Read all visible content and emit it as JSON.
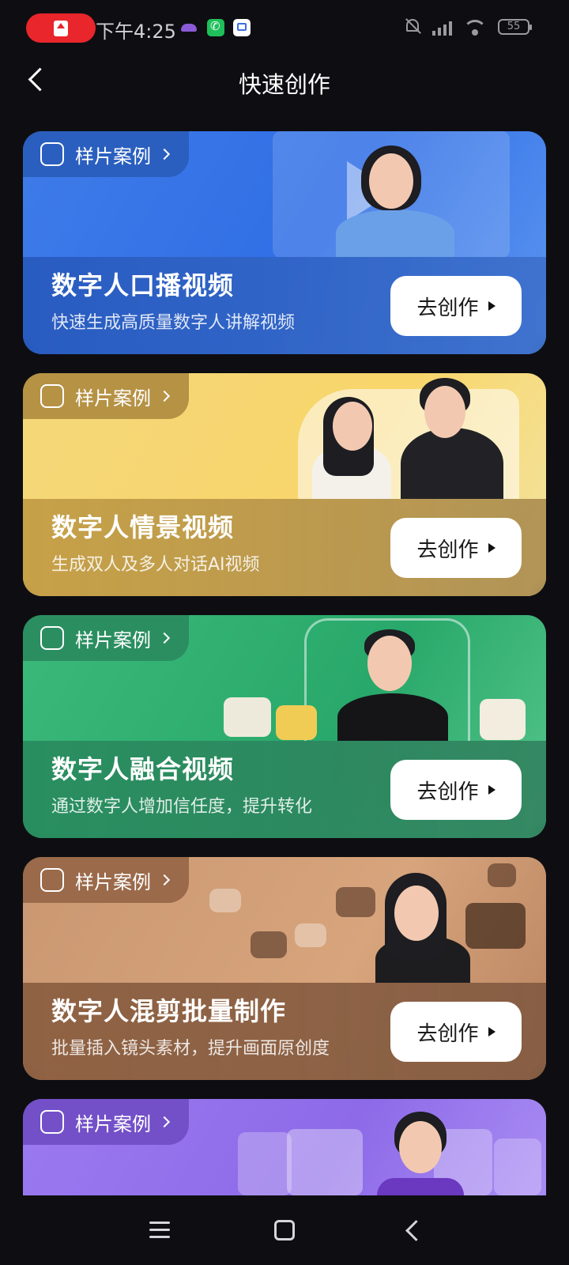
{
  "status_bar": {
    "time": "下午4:25",
    "battery": "55"
  },
  "header": {
    "title": "快速创作"
  },
  "cards": [
    {
      "tag_label": "样片案例",
      "tag_icon": "play-square-plus-icon",
      "title": "数字人口播视频",
      "subtitle": "快速生成高质量数字人讲解视频",
      "button_label": "去创作",
      "accent": "#2f6ee6"
    },
    {
      "tag_label": "样片案例",
      "tag_icon": "clapperboard-icon",
      "title": "数字人情景视频",
      "subtitle": "生成双人及多人对话AI视频",
      "button_label": "去创作",
      "accent": "#f8d66b"
    },
    {
      "tag_label": "样片案例",
      "tag_icon": "shopping-bag-icon",
      "title": "数字人融合视频",
      "subtitle": "通过数字人增加信任度，提升转化",
      "button_label": "去创作",
      "accent": "#28a86a"
    },
    {
      "tag_label": "样片案例",
      "tag_icon": "video-stack-icon",
      "title": "数字人混剪批量制作",
      "subtitle": "批量插入镜头素材，提升画面原创度",
      "button_label": "去创作",
      "accent": "#d7a47c"
    },
    {
      "tag_label": "样片案例",
      "tag_icon": "person-ai-icon",
      "accent": "#9b7af0"
    }
  ]
}
